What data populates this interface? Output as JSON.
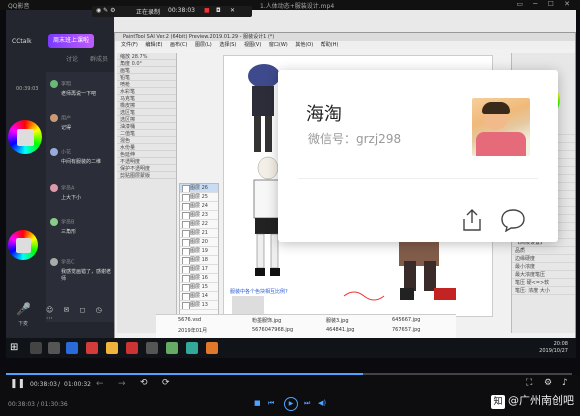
{
  "player": {
    "app_label": "QQ影音",
    "window_title": "1.人体动态+服装设计.mp4",
    "current_time": "00:38:03",
    "total_time": "01:00:32",
    "bottom_time": "00:38:03 / 01:30:36",
    "progress_fraction": 0.63,
    "watermark": "@广州南创吧",
    "watermark_badge": "知"
  },
  "recorder": {
    "time": "00:38:03",
    "label": "正在录制"
  },
  "cctalk": {
    "logo": "CCtalk",
    "banner": "周末班上课啦",
    "tabs": [
      "讨论",
      "群成员"
    ],
    "timer": "00:39:03",
    "chat": [
      {
        "name": "李明",
        "message": "老师再说一下吧"
      },
      {
        "name": "用户",
        "message": "记得"
      },
      {
        "name": "小花",
        "message": "中间有服装的二维"
      },
      {
        "name": "学员A",
        "message": "上大下小"
      },
      {
        "name": "学员B",
        "message": "三角形"
      },
      {
        "name": "学员C",
        "message": "我感觉画错了，感谢老师"
      }
    ],
    "mic_label": "下麦"
  },
  "sai": {
    "title": "PaintTool SAI Ver.2 (64bit) Preview.2019.01.29 - 服装设计1 (*)",
    "menu": [
      "文件(F)",
      "编辑(E)",
      "画布(C)",
      "图层(L)",
      "选择(S)",
      "视图(V)",
      "窗口(W)",
      "其他(O)",
      "帮助(H)"
    ],
    "left_rows": [
      "缩放 28.7%",
      "角度 0.0°",
      "画笔",
      "铅笔",
      "喷枪",
      "水彩笔",
      "马克笔",
      "橡皮擦",
      "选区笔",
      "选区擦",
      "油漆桶",
      "二值笔",
      "混色",
      "水份量",
      "色延伸",
      "不透明度",
      "保护不透明度",
      "剪贴图层蒙版"
    ],
    "layers": [
      "图层 26",
      "图层 25",
      "图层 24",
      "图层 23",
      "图层 22",
      "图层 21",
      "图层 20",
      "图层 19",
      "图层 18",
      "图层 17",
      "图层 16",
      "图层 15",
      "图层 14",
      "图层 13"
    ],
    "right_rows": [
      "导航器",
      "颜色",
      "色轮",
      "工具",
      "画笔大小",
      "最小大小",
      "画笔浓度",
      "画笔形状",
      "画笔纹理",
      "混色",
      "水份量",
      "色延伸",
      "维持不透明",
      "模糊笔压",
      "【高级设置】",
      "品质",
      "边缘硬度",
      "最小浓度",
      "最大浓度笔压",
      "笔压 硬<=>软",
      "笔压: 浓度 大小"
    ],
    "canvas_caption": "服装中各个色块相互比例?",
    "downloads": [
      "5676.vsd",
      "2019年01月",
      "粉墨服饰.jpg",
      "5676047968.jpg",
      "服装3.jpg",
      "464841.jpg",
      "645667.jpg",
      "767657.jpg"
    ]
  },
  "card": {
    "name": "海淘",
    "wechat": "微信号：grzj298"
  },
  "taskbar": {
    "time": "20:08",
    "date": "2019/10/27"
  }
}
